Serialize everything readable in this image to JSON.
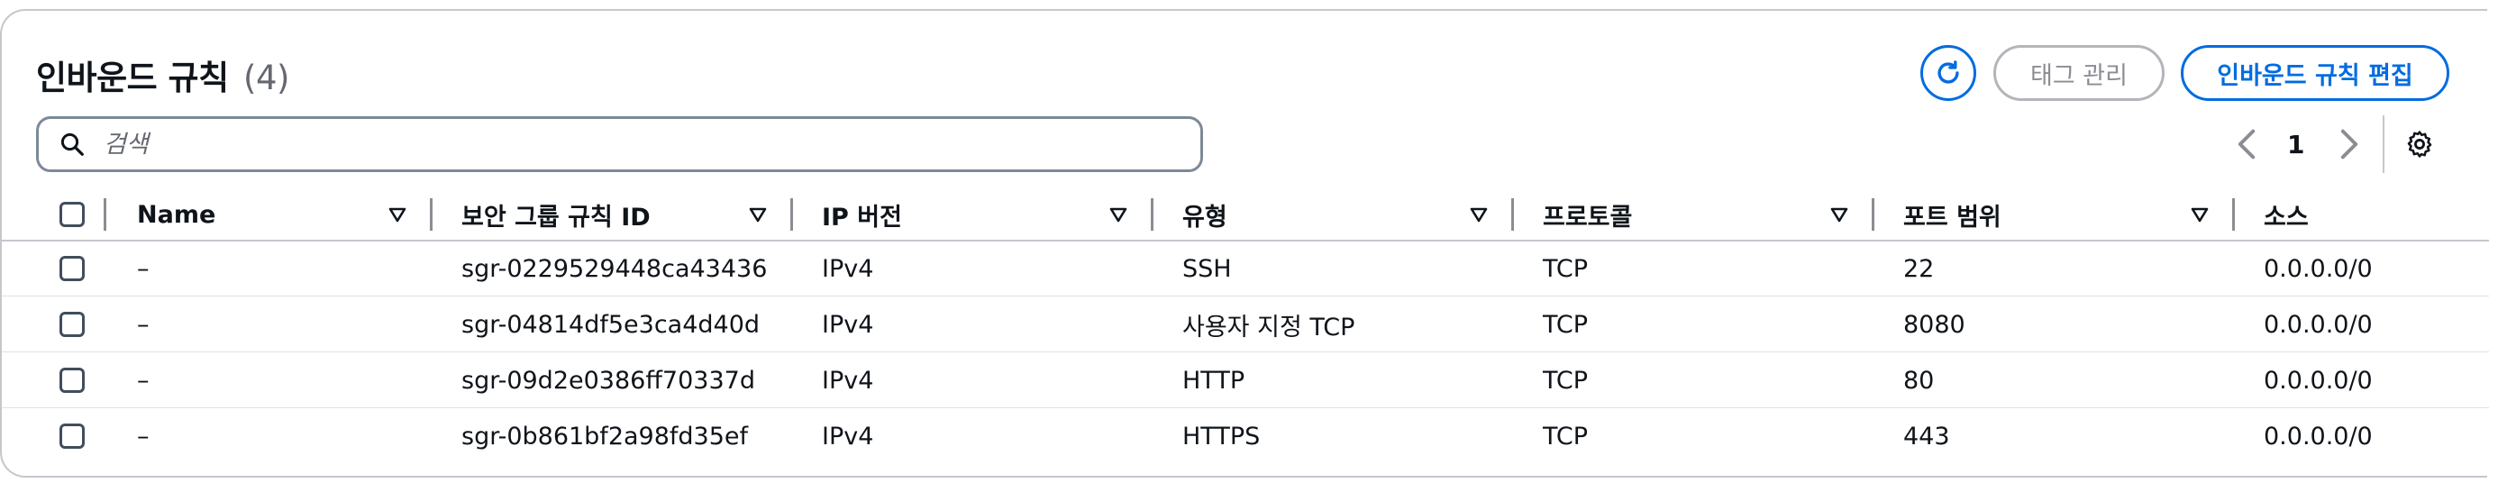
{
  "header": {
    "title": "인바운드 규칙",
    "count": "(4)",
    "tag_button_label": "태그 관리",
    "edit_button_label": "인바운드 규칙 편집"
  },
  "search": {
    "placeholder": "검색",
    "value": ""
  },
  "pagination": {
    "current_page": "1"
  },
  "columns": [
    "Name",
    "보안 그룹 규칙 ID",
    "IP 버전",
    "유형",
    "프로토콜",
    "포트 범위",
    "소스"
  ],
  "rows": [
    {
      "name": "–",
      "rule_id": "sgr-0229529448ca43436",
      "ip_version": "IPv4",
      "type": "SSH",
      "protocol": "TCP",
      "port_range": "22",
      "source": "0.0.0.0/0"
    },
    {
      "name": "–",
      "rule_id": "sgr-04814df5e3ca4d40d",
      "ip_version": "IPv4",
      "type": "사용자 지정 TCP",
      "protocol": "TCP",
      "port_range": "8080",
      "source": "0.0.0.0/0"
    },
    {
      "name": "–",
      "rule_id": "sgr-09d2e0386ff70337d",
      "ip_version": "IPv4",
      "type": "HTTP",
      "protocol": "TCP",
      "port_range": "80",
      "source": "0.0.0.0/0"
    },
    {
      "name": "–",
      "rule_id": "sgr-0b861bf2a98fd35ef",
      "ip_version": "IPv4",
      "type": "HTTPS",
      "protocol": "TCP",
      "port_range": "443",
      "source": "0.0.0.0/0"
    }
  ],
  "icons": {
    "refresh": "refresh-icon",
    "search": "search-icon",
    "prev": "chevron-left-icon",
    "next": "chevron-right-icon",
    "settings": "gear-icon",
    "sort": "sort-caret-down-icon"
  },
  "colors": {
    "accent": "#006ce0",
    "text": "#0f141a",
    "muted": "#656871",
    "border": "#c6c6cd"
  }
}
